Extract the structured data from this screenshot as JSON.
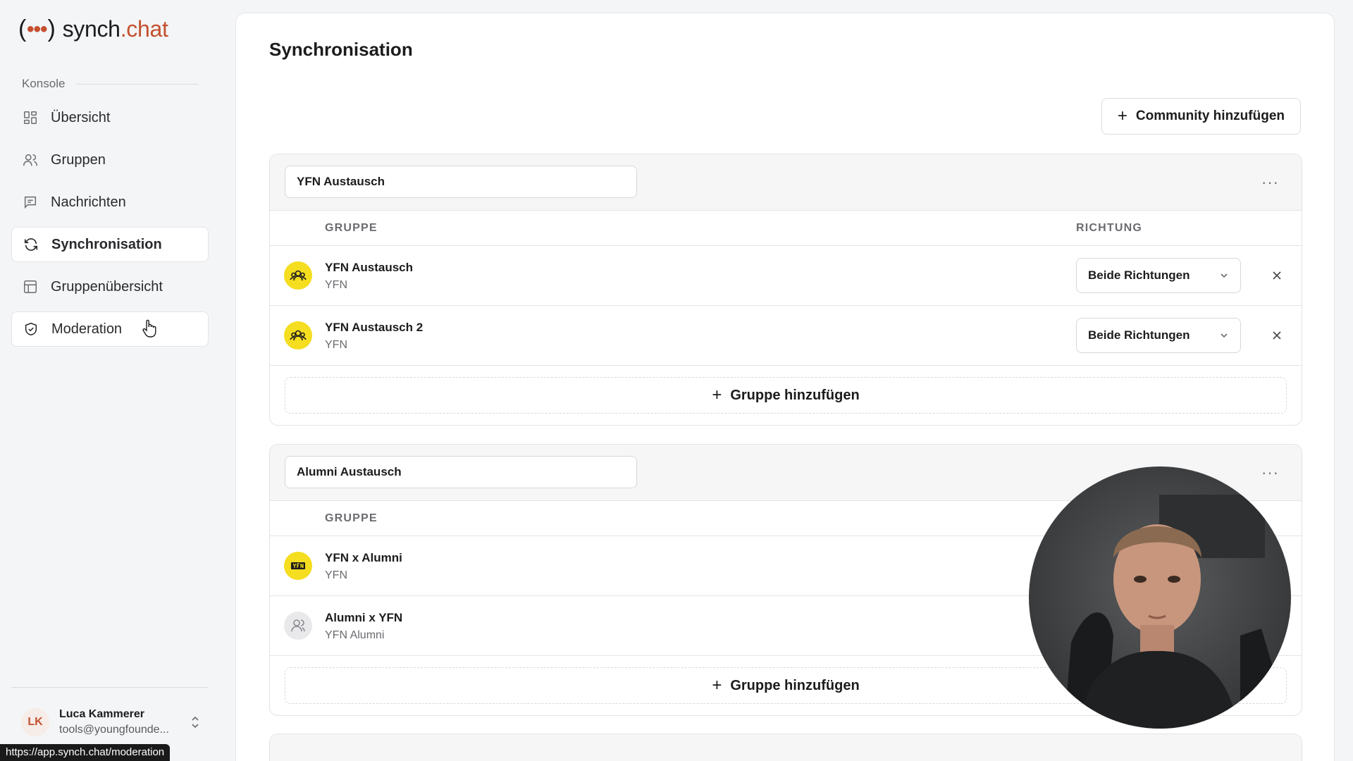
{
  "brand": {
    "paren_open": "(",
    "dots": "•••",
    "paren_close": ")",
    "name": "synch",
    "tld": ".chat"
  },
  "sidebar": {
    "section_label": "Konsole",
    "items": [
      {
        "label": "Übersicht",
        "icon": "grid-icon"
      },
      {
        "label": "Gruppen",
        "icon": "users-icon"
      },
      {
        "label": "Nachrichten",
        "icon": "message-icon"
      },
      {
        "label": "Synchronisation",
        "icon": "sync-icon",
        "active": true
      },
      {
        "label": "Gruppenübersicht",
        "icon": "table-icon"
      },
      {
        "label": "Moderation",
        "icon": "shield-icon",
        "hover": true
      }
    ],
    "user": {
      "initials": "LK",
      "name": "Luca Kammerer",
      "email": "tools@youngfounde..."
    }
  },
  "status_url": "https://app.synch.chat/moderation",
  "main": {
    "title": "Synchronisation",
    "add_community_plus": "+",
    "add_community_label": "Community hinzufügen",
    "cards": [
      {
        "name": "YFN Austausch",
        "more": "···",
        "col_group": "GRUPPE",
        "col_direction": "RICHTUNG",
        "rows": [
          {
            "name": "YFN Austausch",
            "sub": "YFN",
            "direction": "Beide Richtungen"
          },
          {
            "name": "YFN Austausch 2",
            "sub": "YFN",
            "direction": "Beide Richtungen"
          }
        ],
        "add_plus": "+",
        "add_label": "Gruppe hinzufügen"
      },
      {
        "name": "Alumni Austausch",
        "more": "···",
        "col_group": "GRUPPE",
        "rows": [
          {
            "name": "YFN x Alumni",
            "sub": "YFN"
          },
          {
            "name": "Alumni x YFN",
            "sub": "YFN Alumni"
          }
        ],
        "add_plus": "+",
        "add_label": "Gruppe hinzufügen"
      }
    ]
  },
  "colors": {
    "accent": "#c4502f",
    "group_avatar": "#f5dd1f"
  }
}
